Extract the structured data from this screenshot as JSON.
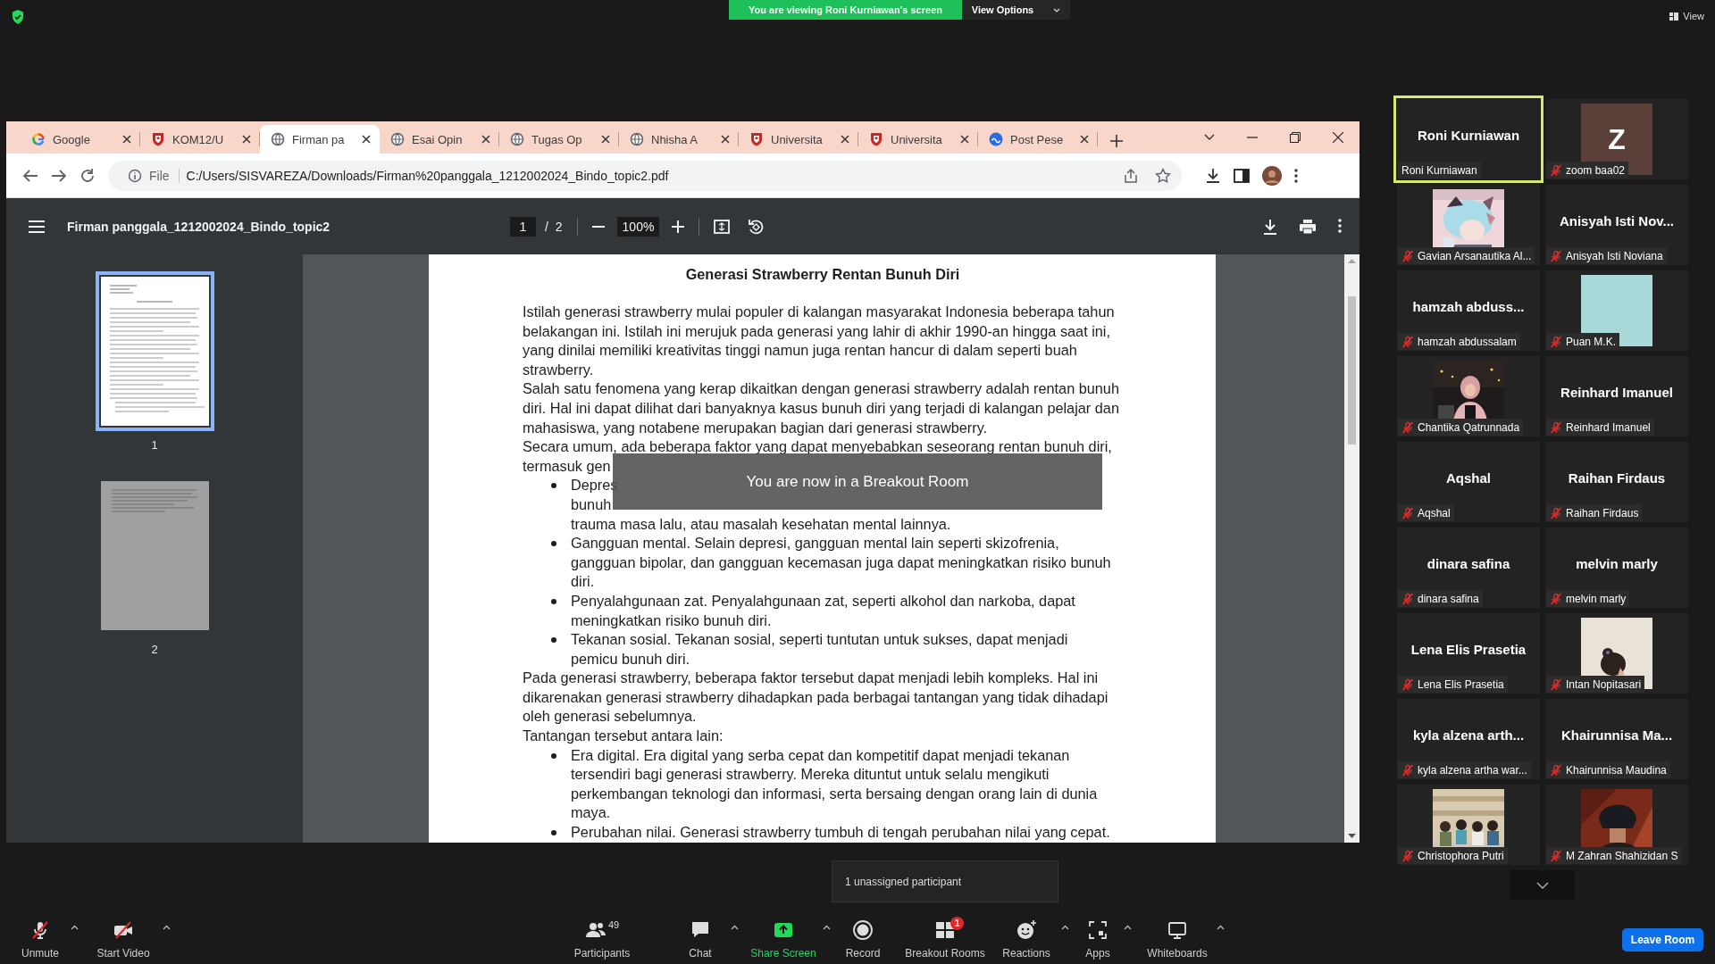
{
  "share_banner": {
    "text": "You are viewing Roni Kurniawan's screen",
    "options_label": "View Options"
  },
  "view_label": "View",
  "browser": {
    "tabs": [
      {
        "title": "Google",
        "kind": "google",
        "selected": false
      },
      {
        "title": "KOM12/U",
        "kind": "shield",
        "selected": false
      },
      {
        "title": "Firman pa",
        "kind": "globe",
        "selected": true
      },
      {
        "title": "Esai Opin",
        "kind": "globe",
        "selected": false
      },
      {
        "title": "Tugas Op",
        "kind": "globe",
        "selected": false
      },
      {
        "title": "Nhisha A",
        "kind": "globe",
        "selected": false
      },
      {
        "title": "Universita",
        "kind": "shield",
        "selected": false
      },
      {
        "title": "Universita",
        "kind": "shield",
        "selected": false
      },
      {
        "title": "Post Pese",
        "kind": "meeting",
        "selected": false
      }
    ],
    "address": {
      "scheme": "File",
      "url": "C:/Users/SISVAREZA/Downloads/Firman%20panggala_1212002024_Bindo_topic2.pdf"
    },
    "pdf": {
      "title": "Firman panggala_1212002024_Bindo_topic2",
      "page": "1",
      "page_of": "/ 2",
      "zoom": "100%",
      "thumbnails": [
        {
          "label": "1",
          "selected": true,
          "rendered": true
        },
        {
          "label": "2",
          "selected": false,
          "rendered": false
        }
      ],
      "heading": "Generasi Strawberry Rentan Bunuh Diri",
      "blocks": [
        {
          "kind": "paragraph",
          "text": "Istilah generasi strawberry mulai populer di kalangan masyarakat Indonesia beberapa tahun belakangan ini. Istilah ini merujuk pada generasi yang lahir di akhir 1990-an hingga saat ini, yang dinilai memiliki kreativitas tinggi namun juga rentan hancur di dalam seperti buah strawberry."
        },
        {
          "kind": "paragraph",
          "text": "Salah satu fenomena yang kerap dikaitkan dengan generasi strawberry adalah rentan bunuh diri. Hal ini dapat dilihat dari banyaknya kasus bunuh diri yang terjadi di kalangan pelajar dan mahasiswa, yang notabene merupakan bagian dari generasi strawberry."
        },
        {
          "kind": "paragraph",
          "lines": [
            "Secara umum, ada beberapa faktor yang dapat menyebabkan seseorang rentan bunuh diri,",
            "termasuk gen"
          ]
        },
        {
          "kind": "bullet",
          "lines": [
            "Depres",
            "bunuh",
            "trauma masa lalu, atau masalah kesehatan mental lainnya."
          ]
        },
        {
          "kind": "bullet",
          "text": "Gangguan mental. Selain depresi, gangguan mental lain seperti skizofrenia, gangguan bipolar, dan gangguan kecemasan juga dapat meningkatkan risiko bunuh diri."
        },
        {
          "kind": "bullet",
          "text": "Penyalahgunaan zat. Penyalahgunaan zat, seperti alkohol dan narkoba, dapat meningkatkan risiko bunuh diri."
        },
        {
          "kind": "bullet",
          "text": "Tekanan sosial. Tekanan sosial, seperti tuntutan untuk sukses, dapat menjadi pemicu bunuh diri."
        },
        {
          "kind": "paragraph",
          "text": "Pada generasi strawberry, beberapa faktor tersebut dapat menjadi lebih kompleks. Hal ini dikarenakan generasi strawberry dihadapkan pada berbagai tantangan yang tidak dihadapi oleh generasi sebelumnya."
        },
        {
          "kind": "paragraph",
          "text": "Tantangan tersebut antara lain:"
        },
        {
          "kind": "bullet",
          "text": "Era digital. Era digital yang serba cepat dan kompetitif dapat menjadi tekanan tersendiri bagi generasi strawberry. Mereka dituntut untuk selalu mengikuti perkembangan teknologi dan informasi, serta bersaing dengan orang lain di dunia maya."
        },
        {
          "kind": "bullet",
          "text": "Perubahan nilai. Generasi strawberry tumbuh di tengah perubahan nilai yang cepat."
        }
      ]
    }
  },
  "notification": "You are now in a Breakout Room",
  "participants": [
    {
      "kind": "name",
      "tile_name": "Roni Kurniawan",
      "label": "Roni Kurniawan",
      "muted": false,
      "active": true
    },
    {
      "kind": "letter",
      "initial": "Z",
      "color": "#5b4039",
      "label": "zoom baa02",
      "muted": true,
      "active": false
    },
    {
      "kind": "picture",
      "label": "Gavian Arsanautika Al...",
      "muted": true,
      "active": false
    },
    {
      "kind": "name",
      "tile_name": "Anisyah Isti Nov...",
      "label": "Anisyah Isti Noviana",
      "muted": true,
      "active": false
    },
    {
      "kind": "name",
      "tile_name": "hamzah abduss...",
      "label": "hamzah abdussalam",
      "muted": true,
      "active": false
    },
    {
      "kind": "block",
      "color": "#a8d8d8",
      "label": "Puan M.K.",
      "muted": true,
      "active": false
    },
    {
      "kind": "picture",
      "label": "Chantika Qatrunnada",
      "muted": true,
      "active": false
    },
    {
      "kind": "name",
      "tile_name": "Reinhard Imanuel",
      "label": "Reinhard Imanuel",
      "muted": true,
      "active": false
    },
    {
      "kind": "name",
      "tile_name": "Aqshal",
      "label": "Aqshal",
      "muted": true,
      "active": false
    },
    {
      "kind": "name",
      "tile_name": "Raihan Firdaus",
      "label": "Raihan Firdaus",
      "muted": true,
      "active": false
    },
    {
      "kind": "name",
      "tile_name": "dinara safina",
      "label": "dinara safina",
      "muted": true,
      "active": false
    },
    {
      "kind": "name",
      "tile_name": "melvin marly",
      "label": "melvin marly",
      "muted": true,
      "active": false
    },
    {
      "kind": "name",
      "tile_name": "Lena Elis Prasetia",
      "label": "Lena Elis Prasetia",
      "muted": true,
      "active": false
    },
    {
      "kind": "picture",
      "label": "Intan Nopitasari",
      "muted": true,
      "active": false
    },
    {
      "kind": "name",
      "tile_name": "kyla alzena arth...",
      "label": "kyla alzena artha war...",
      "muted": true,
      "active": false
    },
    {
      "kind": "name",
      "tile_name": "Khairunnisa Ma...",
      "label": "Khairunnisa Maudina",
      "muted": true,
      "active": false
    },
    {
      "kind": "picture",
      "label": "Christophora Putri",
      "muted": true,
      "active": false
    },
    {
      "kind": "picture",
      "label": "M Zahran Shahizidan S",
      "muted": true,
      "active": false
    }
  ],
  "toolbar": [
    {
      "kind": "mic",
      "label": "Unmute",
      "muted": true,
      "caret": true
    },
    {
      "kind": "video",
      "label": "Start Video",
      "muted": true,
      "caret": true
    },
    {
      "kind": "participants",
      "label": "Participants",
      "count": "49",
      "caret": false
    },
    {
      "kind": "chat",
      "label": "Chat",
      "caret": true
    },
    {
      "kind": "share",
      "label": "Share Screen",
      "caret": true
    },
    {
      "kind": "record",
      "label": "Record",
      "caret": false
    },
    {
      "kind": "breakout",
      "label": "Breakout Rooms",
      "badge": "1",
      "caret": false
    },
    {
      "kind": "reactions",
      "label": "Reactions",
      "caret": true
    },
    {
      "kind": "apps",
      "label": "Apps",
      "caret": true
    },
    {
      "kind": "whiteboards",
      "label": "Whiteboards",
      "caret": true
    }
  ],
  "tooltip": "1 unassigned participant",
  "leave_label": "Leave Room"
}
